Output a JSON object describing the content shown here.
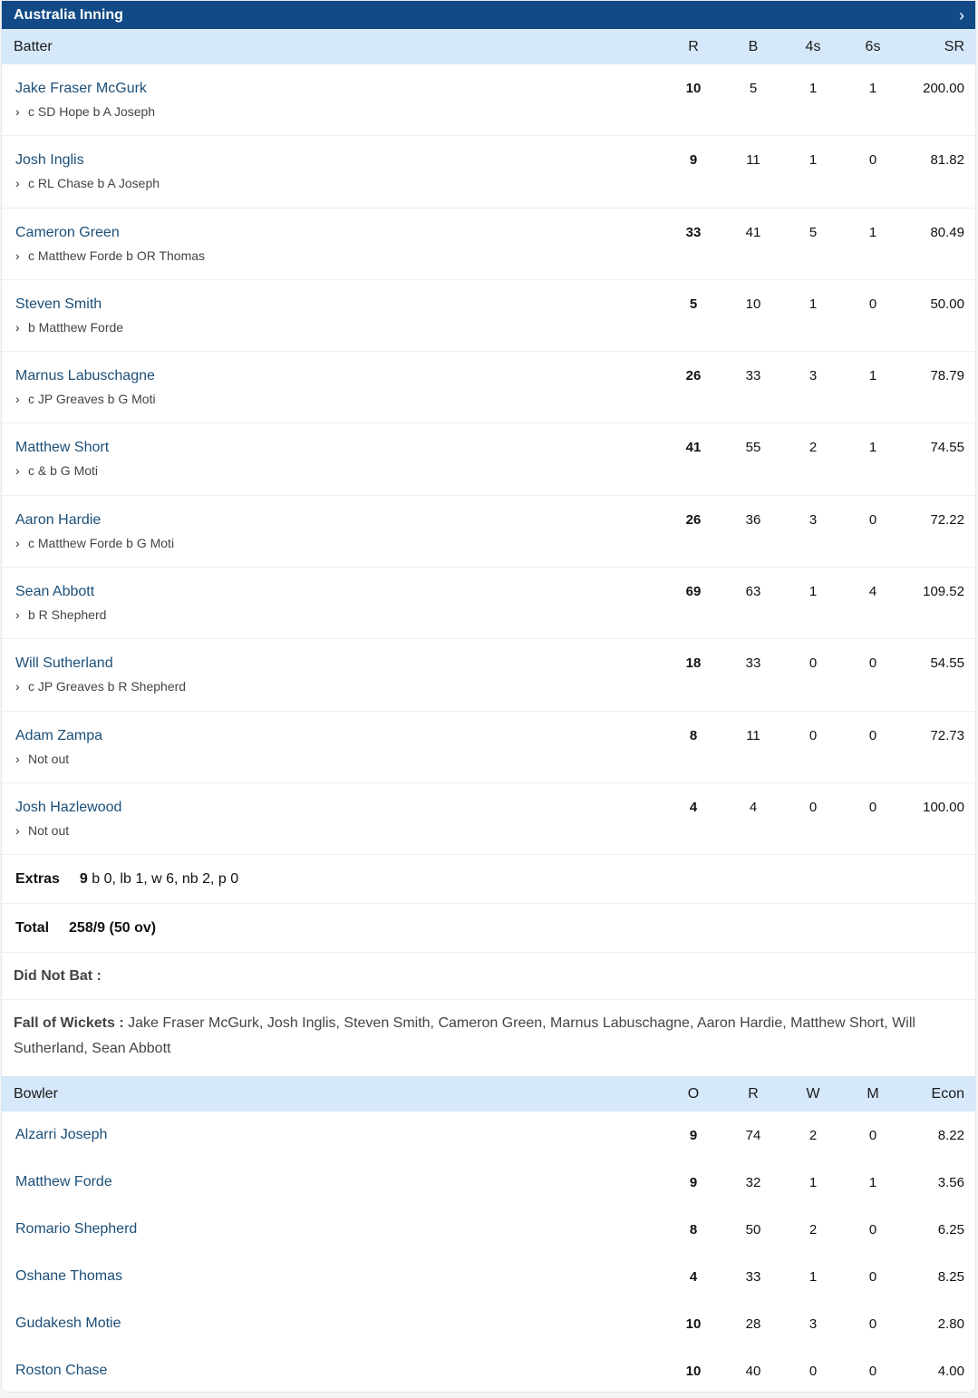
{
  "header": {
    "title": "Australia Inning",
    "chevron_icon": "chevron-right-icon"
  },
  "batting": {
    "columns": [
      "Batter",
      "R",
      "B",
      "4s",
      "6s",
      "SR"
    ],
    "rows": [
      {
        "name": "Jake Fraser McGurk",
        "dismissal": "c SD Hope b A Joseph",
        "R": "10",
        "B": "5",
        "4s": "1",
        "6s": "1",
        "SR": "200.00"
      },
      {
        "name": "Josh Inglis",
        "dismissal": "c RL Chase b A Joseph",
        "R": "9",
        "B": "11",
        "4s": "1",
        "6s": "0",
        "SR": "81.82"
      },
      {
        "name": "Cameron Green",
        "dismissal": "c Matthew Forde b OR Thomas",
        "R": "33",
        "B": "41",
        "4s": "5",
        "6s": "1",
        "SR": "80.49"
      },
      {
        "name": "Steven Smith",
        "dismissal": "b Matthew Forde",
        "R": "5",
        "B": "10",
        "4s": "1",
        "6s": "0",
        "SR": "50.00"
      },
      {
        "name": "Marnus Labuschagne",
        "dismissal": "c JP Greaves b G Moti",
        "R": "26",
        "B": "33",
        "4s": "3",
        "6s": "1",
        "SR": "78.79"
      },
      {
        "name": "Matthew Short",
        "dismissal": "c & b G Moti",
        "R": "41",
        "B": "55",
        "4s": "2",
        "6s": "1",
        "SR": "74.55"
      },
      {
        "name": "Aaron Hardie",
        "dismissal": "c Matthew Forde b G Moti",
        "R": "26",
        "B": "36",
        "4s": "3",
        "6s": "0",
        "SR": "72.22"
      },
      {
        "name": "Sean Abbott",
        "dismissal": "b R Shepherd",
        "R": "69",
        "B": "63",
        "4s": "1",
        "6s": "4",
        "SR": "109.52"
      },
      {
        "name": "Will Sutherland",
        "dismissal": "c JP Greaves b R Shepherd",
        "R": "18",
        "B": "33",
        "4s": "0",
        "6s": "0",
        "SR": "54.55"
      },
      {
        "name": "Adam Zampa",
        "dismissal": "Not out",
        "R": "8",
        "B": "11",
        "4s": "0",
        "6s": "0",
        "SR": "72.73"
      },
      {
        "name": "Josh Hazlewood",
        "dismissal": "Not out",
        "R": "4",
        "B": "4",
        "4s": "0",
        "6s": "0",
        "SR": "100.00"
      }
    ]
  },
  "extras": {
    "label": "Extras",
    "total": "9",
    "detail": "b 0, lb 1, w 6, nb 2, p 0"
  },
  "total": {
    "label": "Total",
    "value": "258/9 (50 ov)"
  },
  "did_not_bat": {
    "label": "Did Not Bat :"
  },
  "fall_of_wickets": {
    "label": "Fall of Wickets :",
    "value": "Jake Fraser McGurk, Josh Inglis, Steven Smith, Cameron Green, Marnus Labuschagne, Aaron Hardie, Matthew Short, Will Sutherland, Sean Abbott"
  },
  "bowling": {
    "columns": [
      "Bowler",
      "O",
      "R",
      "W",
      "M",
      "Econ"
    ],
    "rows": [
      {
        "name": "Alzarri Joseph",
        "O": "9",
        "R": "74",
        "W": "2",
        "M": "0",
        "Econ": "8.22"
      },
      {
        "name": "Matthew Forde",
        "O": "9",
        "R": "32",
        "W": "1",
        "M": "1",
        "Econ": "3.56"
      },
      {
        "name": "Romario Shepherd",
        "O": "8",
        "R": "50",
        "W": "2",
        "M": "0",
        "Econ": "6.25"
      },
      {
        "name": "Oshane Thomas",
        "O": "4",
        "R": "33",
        "W": "1",
        "M": "0",
        "Econ": "8.25"
      },
      {
        "name": "Gudakesh Motie",
        "O": "10",
        "R": "28",
        "W": "3",
        "M": "0",
        "Econ": "2.80"
      },
      {
        "name": "Roston Chase",
        "O": "10",
        "R": "40",
        "W": "0",
        "M": "0",
        "Econ": "4.00"
      }
    ]
  },
  "colors": {
    "header_bg": "#114a86",
    "subheader_bg": "#d6e9fb",
    "player_link": "#1c4f78"
  }
}
